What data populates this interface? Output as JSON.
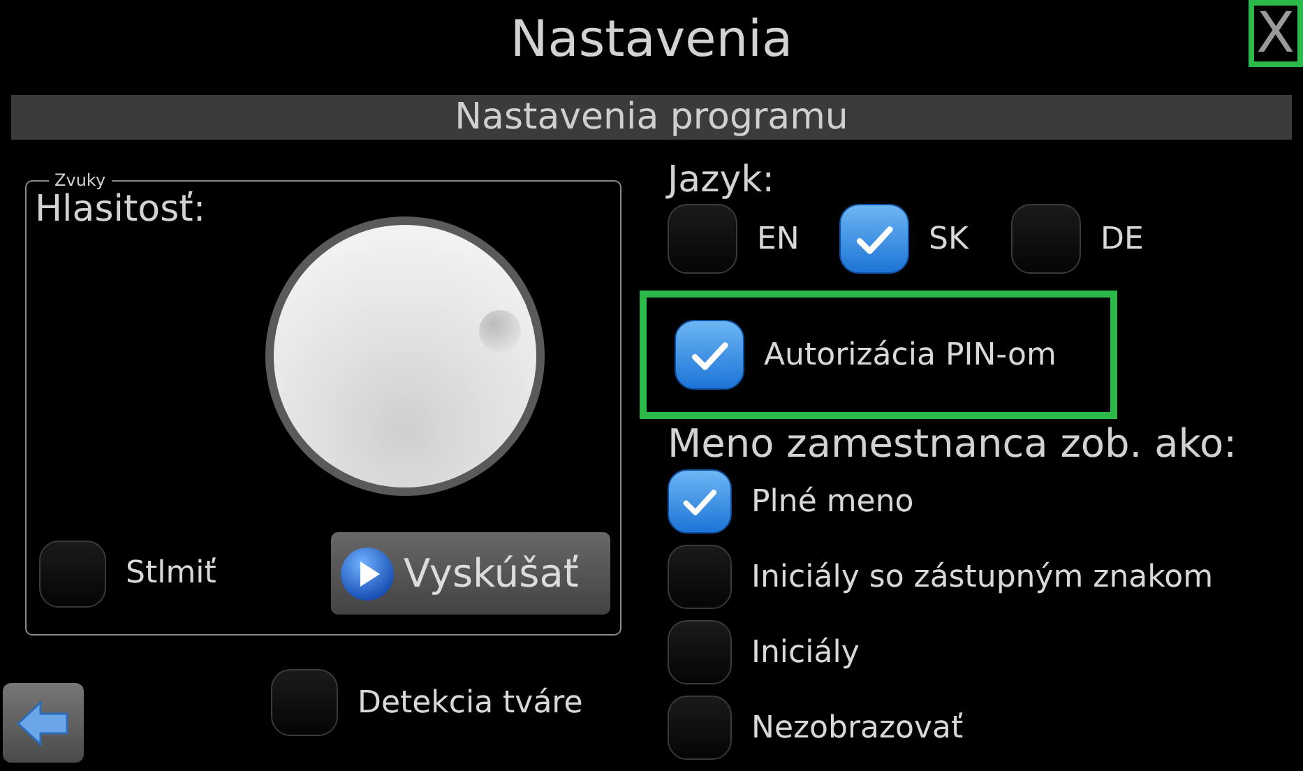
{
  "window": {
    "title": "Nastavenia",
    "close": {
      "label": "X",
      "highlighted": true
    }
  },
  "section": {
    "title": "Nastavenia programu"
  },
  "sounds": {
    "legend": "Zvuky",
    "volume_label": "Hlasitosť:",
    "mute": {
      "label": "Stlmiť",
      "checked": false
    },
    "test_button": "Vyskúšať"
  },
  "face_detection": {
    "label": "Detekcia tváre",
    "checked": false
  },
  "language": {
    "label": "Jazyk:",
    "options": [
      {
        "label": "EN",
        "selected": false
      },
      {
        "label": "SK",
        "selected": true
      },
      {
        "label": "DE",
        "selected": false
      }
    ]
  },
  "pin_auth": {
    "label": "Autorizácia PIN-om",
    "checked": true,
    "highlighted": true
  },
  "employee_name": {
    "label": "Meno zamestnanca zob. ako:",
    "options": [
      {
        "label": "Plné meno",
        "selected": true
      },
      {
        "label": "Iniciály so zástupným znakom",
        "selected": false
      },
      {
        "label": "Iniciály",
        "selected": false
      },
      {
        "label": "Nezobrazovať",
        "selected": false
      }
    ]
  }
}
